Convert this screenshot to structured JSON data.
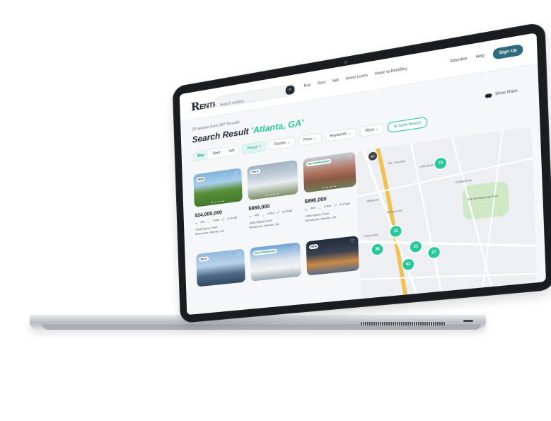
{
  "brand": {
    "logo_letter": "R",
    "logo_text": "ENTRO"
  },
  "nav": {
    "search_placeholder": "Search realtors",
    "links": [
      "Buy",
      "Rent",
      "Sell",
      "Home Loans",
      "Home to Rent/Buy"
    ],
    "advertise": "Advertise",
    "help": "Help",
    "signup": "Sign Up"
  },
  "results": {
    "count_text": "18 appear from 287 Results",
    "title_prefix": "Search Result ",
    "title_location": "'Atlanta, GA'",
    "show_maps": "Show Maps"
  },
  "filters": {
    "segments": [
      "Buy",
      "Rent",
      "Sell"
    ],
    "house": "House",
    "rooms": "Rooms",
    "price": "Price",
    "keywords": "Keywords",
    "more": "More",
    "save_search": "Save Search"
  },
  "listings": [
    {
      "badge": "NEW",
      "price": "$24,000,000",
      "beds": "4bd",
      "baths": "6.5ba",
      "sqft": "6,17sqft",
      "address1": "1998 Wythe Point",
      "address2": "Minnesota, Atlanta, GA"
    },
    {
      "badge": "SALE",
      "price": "$989,000",
      "beds": "4bd",
      "baths": "6.5ba",
      "sqft": "6,12sqft",
      "address1": "1688 Wythe Point",
      "address2": "Minnesota, Atlanta, GA"
    },
    {
      "badge": "RECOMMENDED",
      "price": "$896,000",
      "beds": "4bd",
      "baths": "6.5ba",
      "sqft": "6,17sqft",
      "address1": "1998 Wythe Point",
      "address2": "Minnesota, Atlanta, GA"
    },
    {
      "badge": "SALE"
    },
    {
      "badge": "RECOMMENDED"
    },
    {
      "badge": "NEW"
    }
  ],
  "map": {
    "pins": [
      "73",
      "12",
      "38",
      "21",
      "27",
      "62"
    ],
    "labels": [
      "Cortland Ave",
      "Little Orchard St",
      "San Jose Ave",
      "Oak Hill Memorial Park",
      "Willow St",
      "Almaden Rd",
      "Curtner Ave"
    ],
    "route_marker": "87"
  },
  "colors": {
    "accent": "#27c79a",
    "navy": "#1b2430",
    "button": "#2e6b7d"
  }
}
